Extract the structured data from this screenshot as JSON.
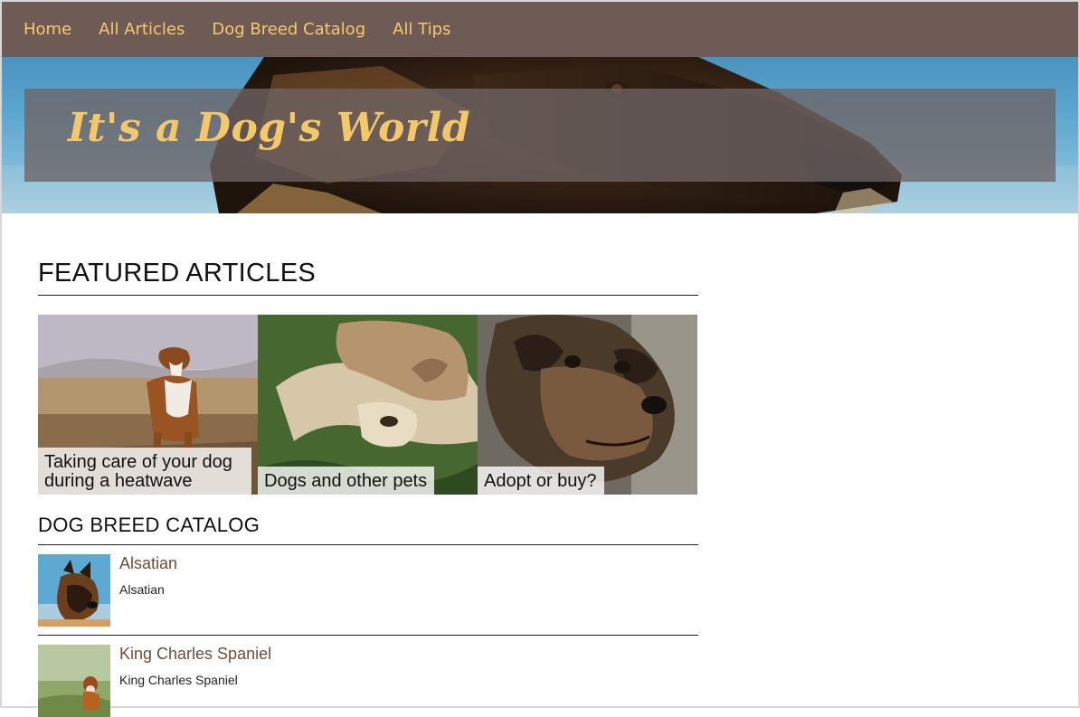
{
  "nav": {
    "items": [
      {
        "label": "Home"
      },
      {
        "label": "All Articles"
      },
      {
        "label": "Dog Breed Catalog"
      },
      {
        "label": "All Tips"
      }
    ]
  },
  "hero": {
    "title": "It's a Dog's World"
  },
  "featured": {
    "heading": "FEATURED ARTICLES",
    "articles": [
      {
        "caption": "Taking care of your dog during a heatwave"
      },
      {
        "caption": "Dogs and other pets"
      },
      {
        "caption": "Adopt or buy?"
      }
    ]
  },
  "catalog": {
    "heading": "DOG BREED CATALOG",
    "breeds": [
      {
        "name": "Alsatian",
        "description": "Alsatian"
      },
      {
        "name": "King Charles Spaniel",
        "description": "King Charles Spaniel"
      }
    ]
  },
  "colors": {
    "nav_bg": "#6e5b55",
    "nav_text": "#f6c96a",
    "title_text": "#f3c86a",
    "breed_link": "#6b4f3a"
  }
}
